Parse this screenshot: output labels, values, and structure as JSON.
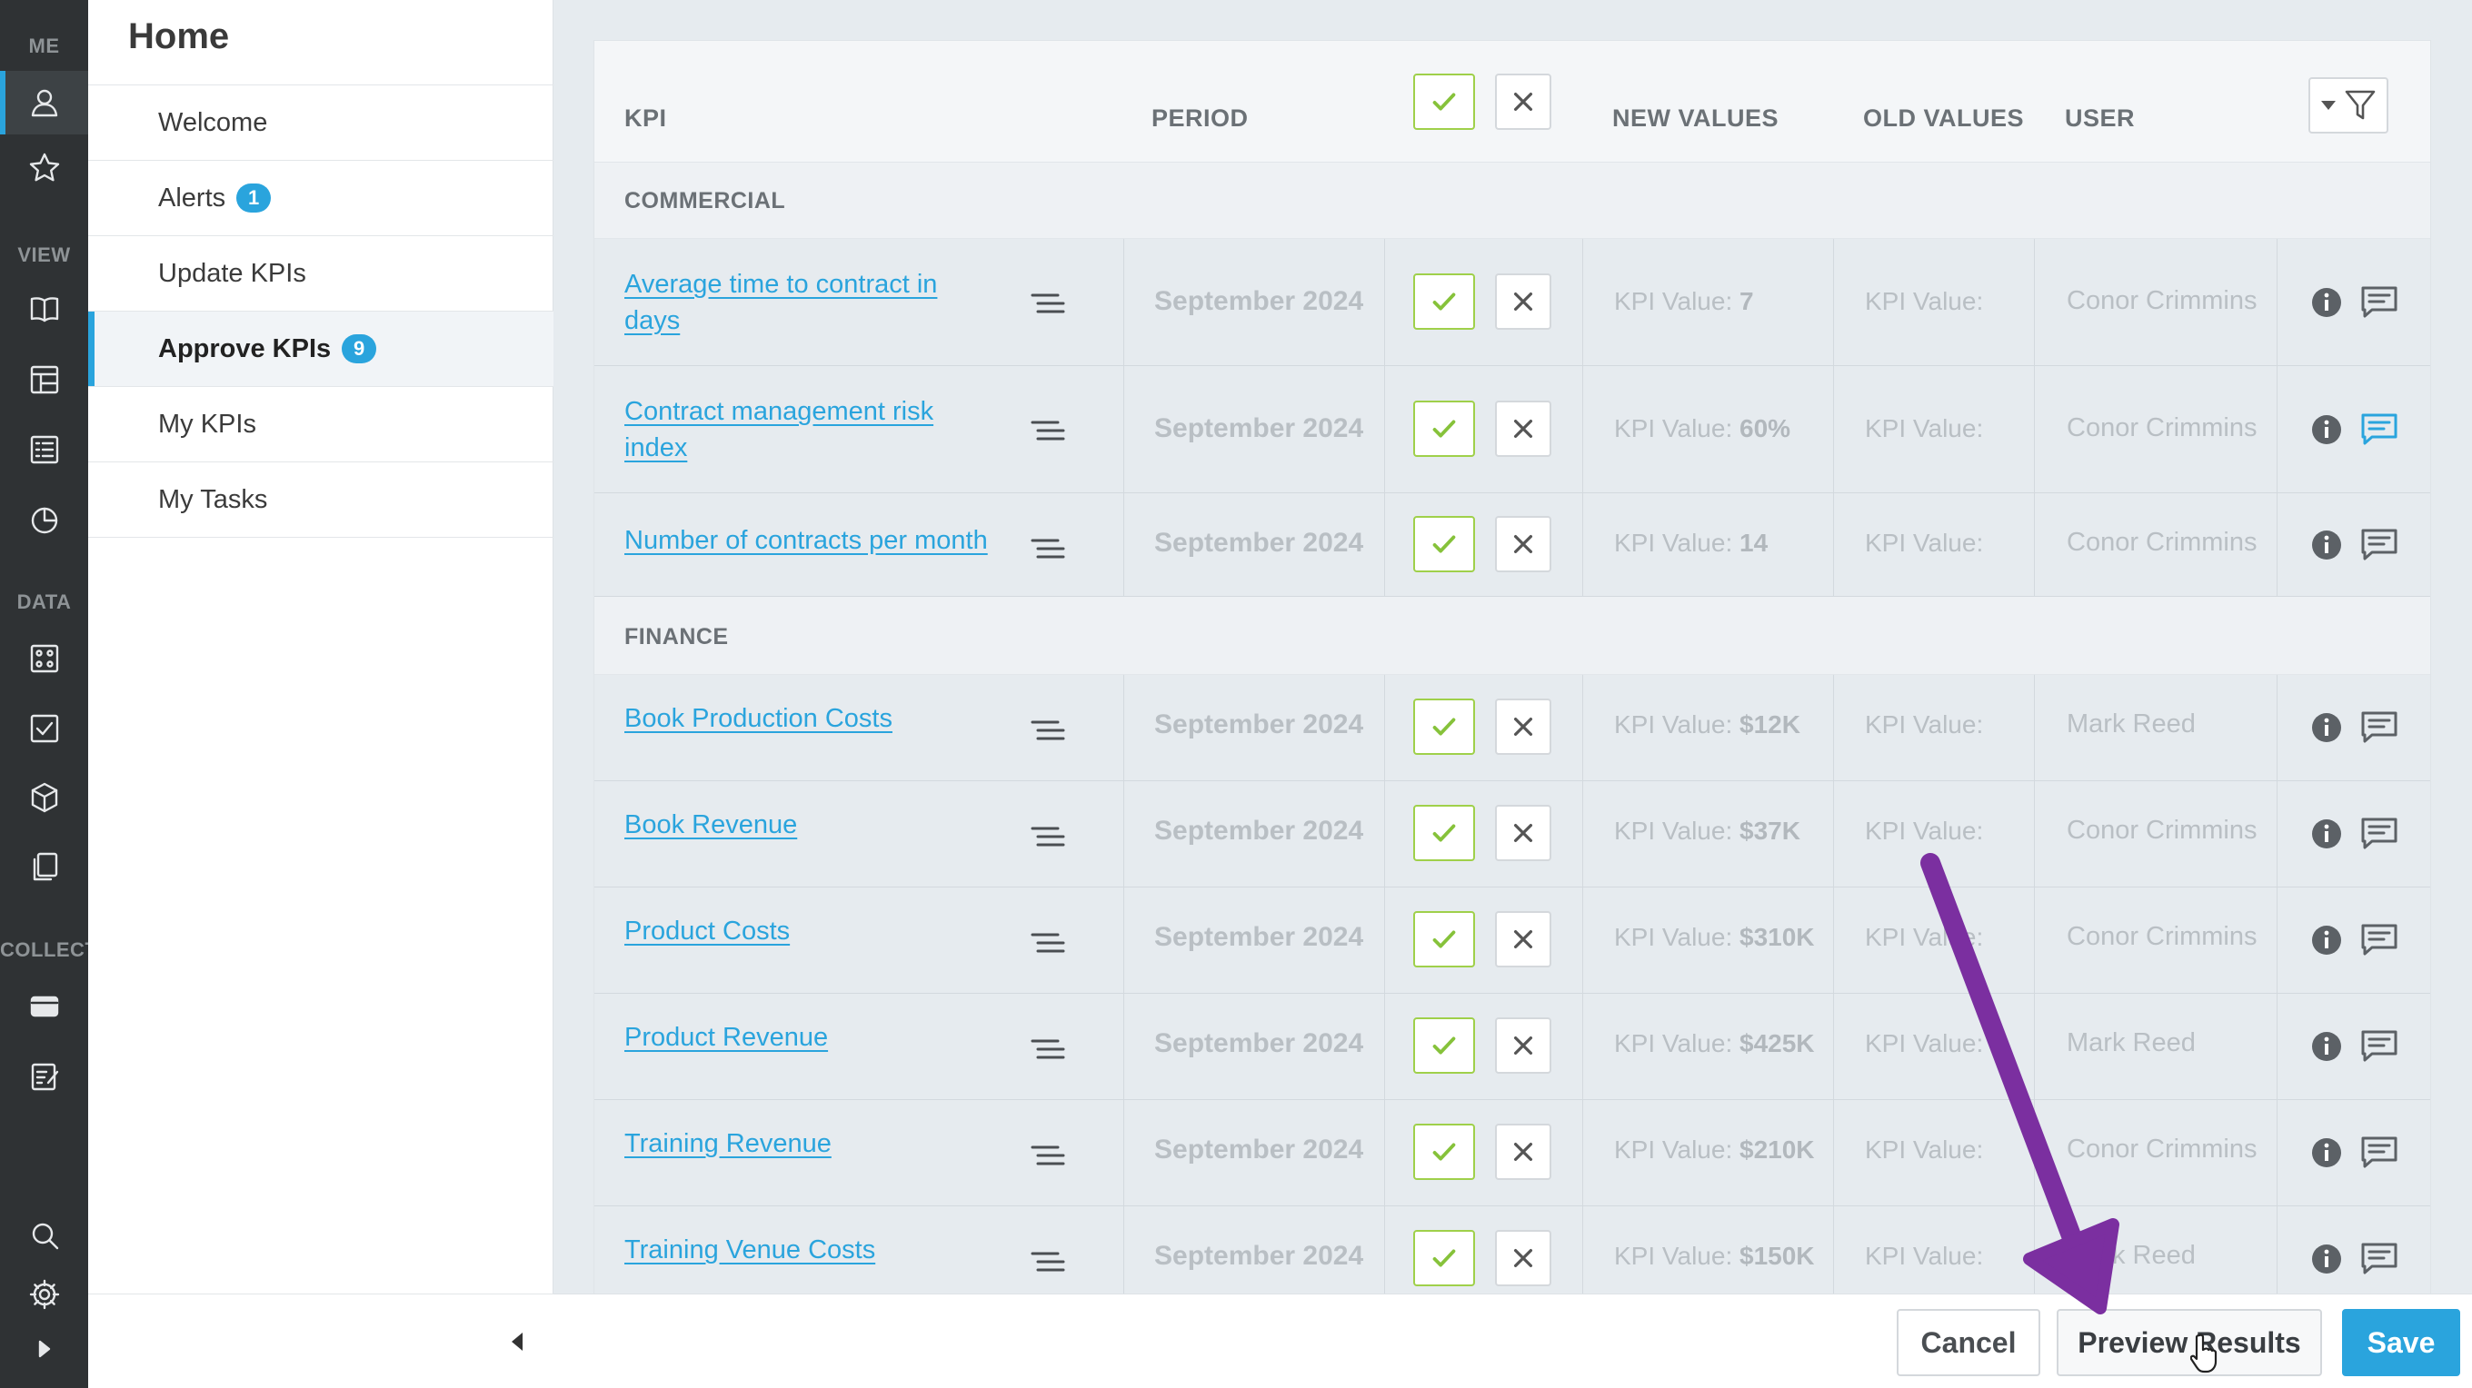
{
  "colors": {
    "accent": "#2aa4dd",
    "approve_green": "#86c23a",
    "rail_bg": "#2f3234",
    "annotation_arrow": "#7b2fa0"
  },
  "rail": {
    "sections": {
      "me": "ME",
      "view": "VIEW",
      "data": "DATA",
      "collect": "COLLECT"
    },
    "icons": [
      "user-icon",
      "star-icon",
      "book-icon",
      "dashboard-icon",
      "list-icon",
      "pie-chart-icon",
      "grid-icon",
      "checkbox-icon",
      "cube-icon",
      "documents-icon",
      "card-icon",
      "form-icon",
      "search-icon",
      "gear-icon",
      "expand-icon"
    ]
  },
  "nav": {
    "title": "Home",
    "items": [
      {
        "label": "Welcome",
        "badge": ""
      },
      {
        "label": "Alerts",
        "badge": "1"
      },
      {
        "label": "Update KPIs",
        "badge": ""
      },
      {
        "label": "Approve KPIs",
        "badge": "9"
      },
      {
        "label": "My KPIs",
        "badge": ""
      },
      {
        "label": "My Tasks",
        "badge": ""
      }
    ]
  },
  "table": {
    "headers": {
      "kpi": "KPI",
      "period": "PERIOD",
      "new_values": "NEW VALUES",
      "old_values": "OLD VALUES",
      "user": "USER"
    },
    "groups": [
      {
        "name": "COMMERCIAL",
        "rows": [
          {
            "kpi": "Average time to contract in days",
            "period": "September 2024",
            "new_prefix": "KPI Value: ",
            "new_value": "7",
            "old": "KPI Value:",
            "user": "Conor Crimmins"
          },
          {
            "kpi": "Contract management risk index",
            "period": "September 2024",
            "new_prefix": "KPI Value: ",
            "new_value": "60%",
            "old": "KPI Value:",
            "user": "Conor Crimmins"
          },
          {
            "kpi": "Number of contracts per month",
            "period": "September 2024",
            "new_prefix": "KPI Value: ",
            "new_value": "14",
            "old": "KPI Value:",
            "user": "Conor Crimmins"
          }
        ]
      },
      {
        "name": "FINANCE",
        "rows": [
          {
            "kpi": "Book Production Costs",
            "period": "September 2024",
            "new_prefix": "KPI Value: ",
            "new_value": "$12K",
            "old": "KPI Value:",
            "user": "Mark Reed"
          },
          {
            "kpi": "Book Revenue",
            "period": "September 2024",
            "new_prefix": "KPI Value: ",
            "new_value": "$37K",
            "old": "KPI Value:",
            "user": "Conor Crimmins"
          },
          {
            "kpi": "Product Costs",
            "period": "September 2024",
            "new_prefix": "KPI Value: ",
            "new_value": "$310K",
            "old": "KPI Value:",
            "user": "Conor Crimmins"
          },
          {
            "kpi": "Product Revenue",
            "period": "September 2024",
            "new_prefix": "KPI Value: ",
            "new_value": "$425K",
            "old": "KPI Value:",
            "user": "Mark Reed"
          },
          {
            "kpi": "Training Revenue",
            "period": "September 2024",
            "new_prefix": "KPI Value: ",
            "new_value": "$210K",
            "old": "KPI Value:",
            "user": "Conor Crimmins"
          },
          {
            "kpi": "Training Venue Costs",
            "period": "September 2024",
            "new_prefix": "KPI Value: ",
            "new_value": "$150K",
            "old": "KPI Value:",
            "user": "Mark Reed"
          }
        ]
      }
    ]
  },
  "footer": {
    "cancel": "Cancel",
    "preview": "Preview Results",
    "save": "Save"
  }
}
